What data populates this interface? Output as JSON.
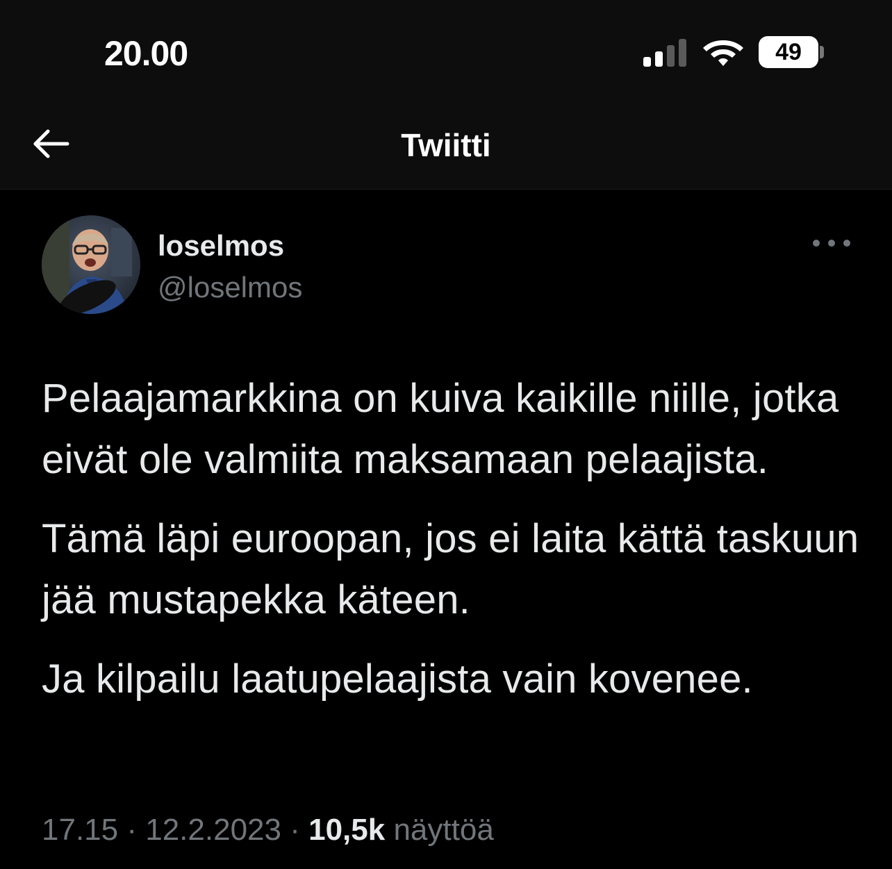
{
  "status_bar": {
    "time": "20.00",
    "battery_level": "49"
  },
  "nav": {
    "title": "Twiitti",
    "back_icon": "arrow-left-icon"
  },
  "tweet": {
    "author": {
      "name": "loselmos",
      "handle": "@loselmos"
    },
    "paragraphs": [
      "Pelaajamarkkina on kuiva kaikille niille, jotka eivät ole valmiita maksamaan pelaajista.",
      "Tämä läpi euroopan, jos ei laita kättä taskuun jää mustapekka käteen.",
      "Ja kilpailu laatupelaajista vain kovenee."
    ],
    "time": "17.15",
    "separator": "·",
    "date": "12.2.2023",
    "views_count": "10,5k",
    "views_label": "näyttöä"
  },
  "colors": {
    "background": "#000000",
    "text": "#e7e9ea",
    "secondary_text": "#71767b"
  }
}
